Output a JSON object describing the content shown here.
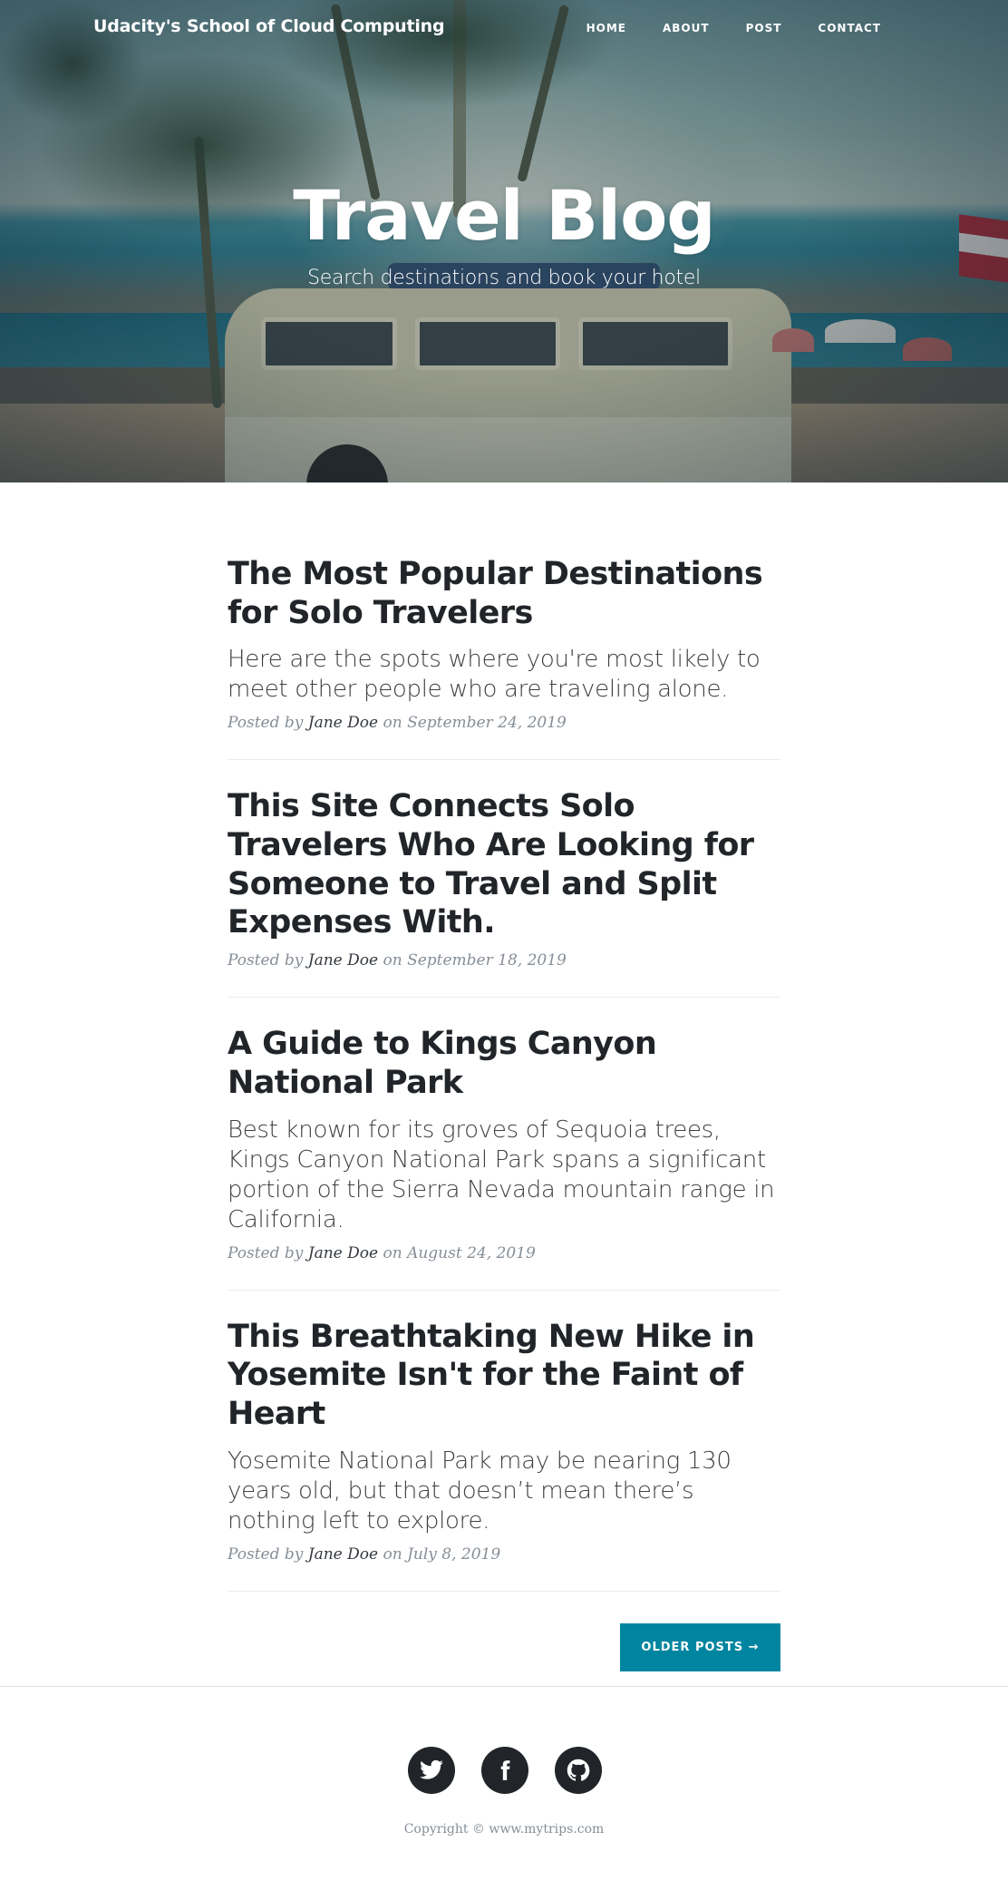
{
  "navbar": {
    "brand": "Udacity's School of Cloud Computing",
    "links": [
      "HOME",
      "ABOUT",
      "POST",
      "CONTACT"
    ]
  },
  "hero": {
    "title": "Travel Blog",
    "subheading": "Search destinations and book your hotel"
  },
  "posts": [
    {
      "title": "The Most Popular Destinations for Solo Travelers",
      "subtitle": "Here are the spots where you're most likely to meet other people who are traveling alone.",
      "posted_by": "Posted by",
      "author": "Jane Doe",
      "date": "on September 24, 2019"
    },
    {
      "title": "This Site Connects Solo Travelers Who Are Looking for Someone to Travel and Split Expenses With.",
      "subtitle": "",
      "posted_by": "Posted by",
      "author": "Jane Doe",
      "date": "on September 18, 2019"
    },
    {
      "title": "A Guide to Kings Canyon National Park",
      "subtitle": "Best known for its groves of Sequoia trees, Kings Canyon National Park spans a significant portion of the Sierra Nevada mountain range in California.",
      "posted_by": "Posted by",
      "author": "Jane Doe",
      "date": "on August 24, 2019"
    },
    {
      "title": "This Breathtaking New Hike in Yosemite Isn't for the Faint of Heart",
      "subtitle": "Yosemite National Park may be nearing 130 years old, but that doesn’t mean there’s nothing left to explore.",
      "posted_by": "Posted by",
      "author": "Jane Doe",
      "date": "on July 8, 2019"
    }
  ],
  "pager": {
    "older_label": "OLDER POSTS →"
  },
  "footer": {
    "social_icons": [
      "twitter-icon",
      "facebook-icon",
      "github-icon"
    ],
    "copyright": "Copyright © www.mytrips.com"
  },
  "colors": {
    "accent": "#0085a1",
    "text_dark": "#212529",
    "meta_gray": "#868e96"
  }
}
